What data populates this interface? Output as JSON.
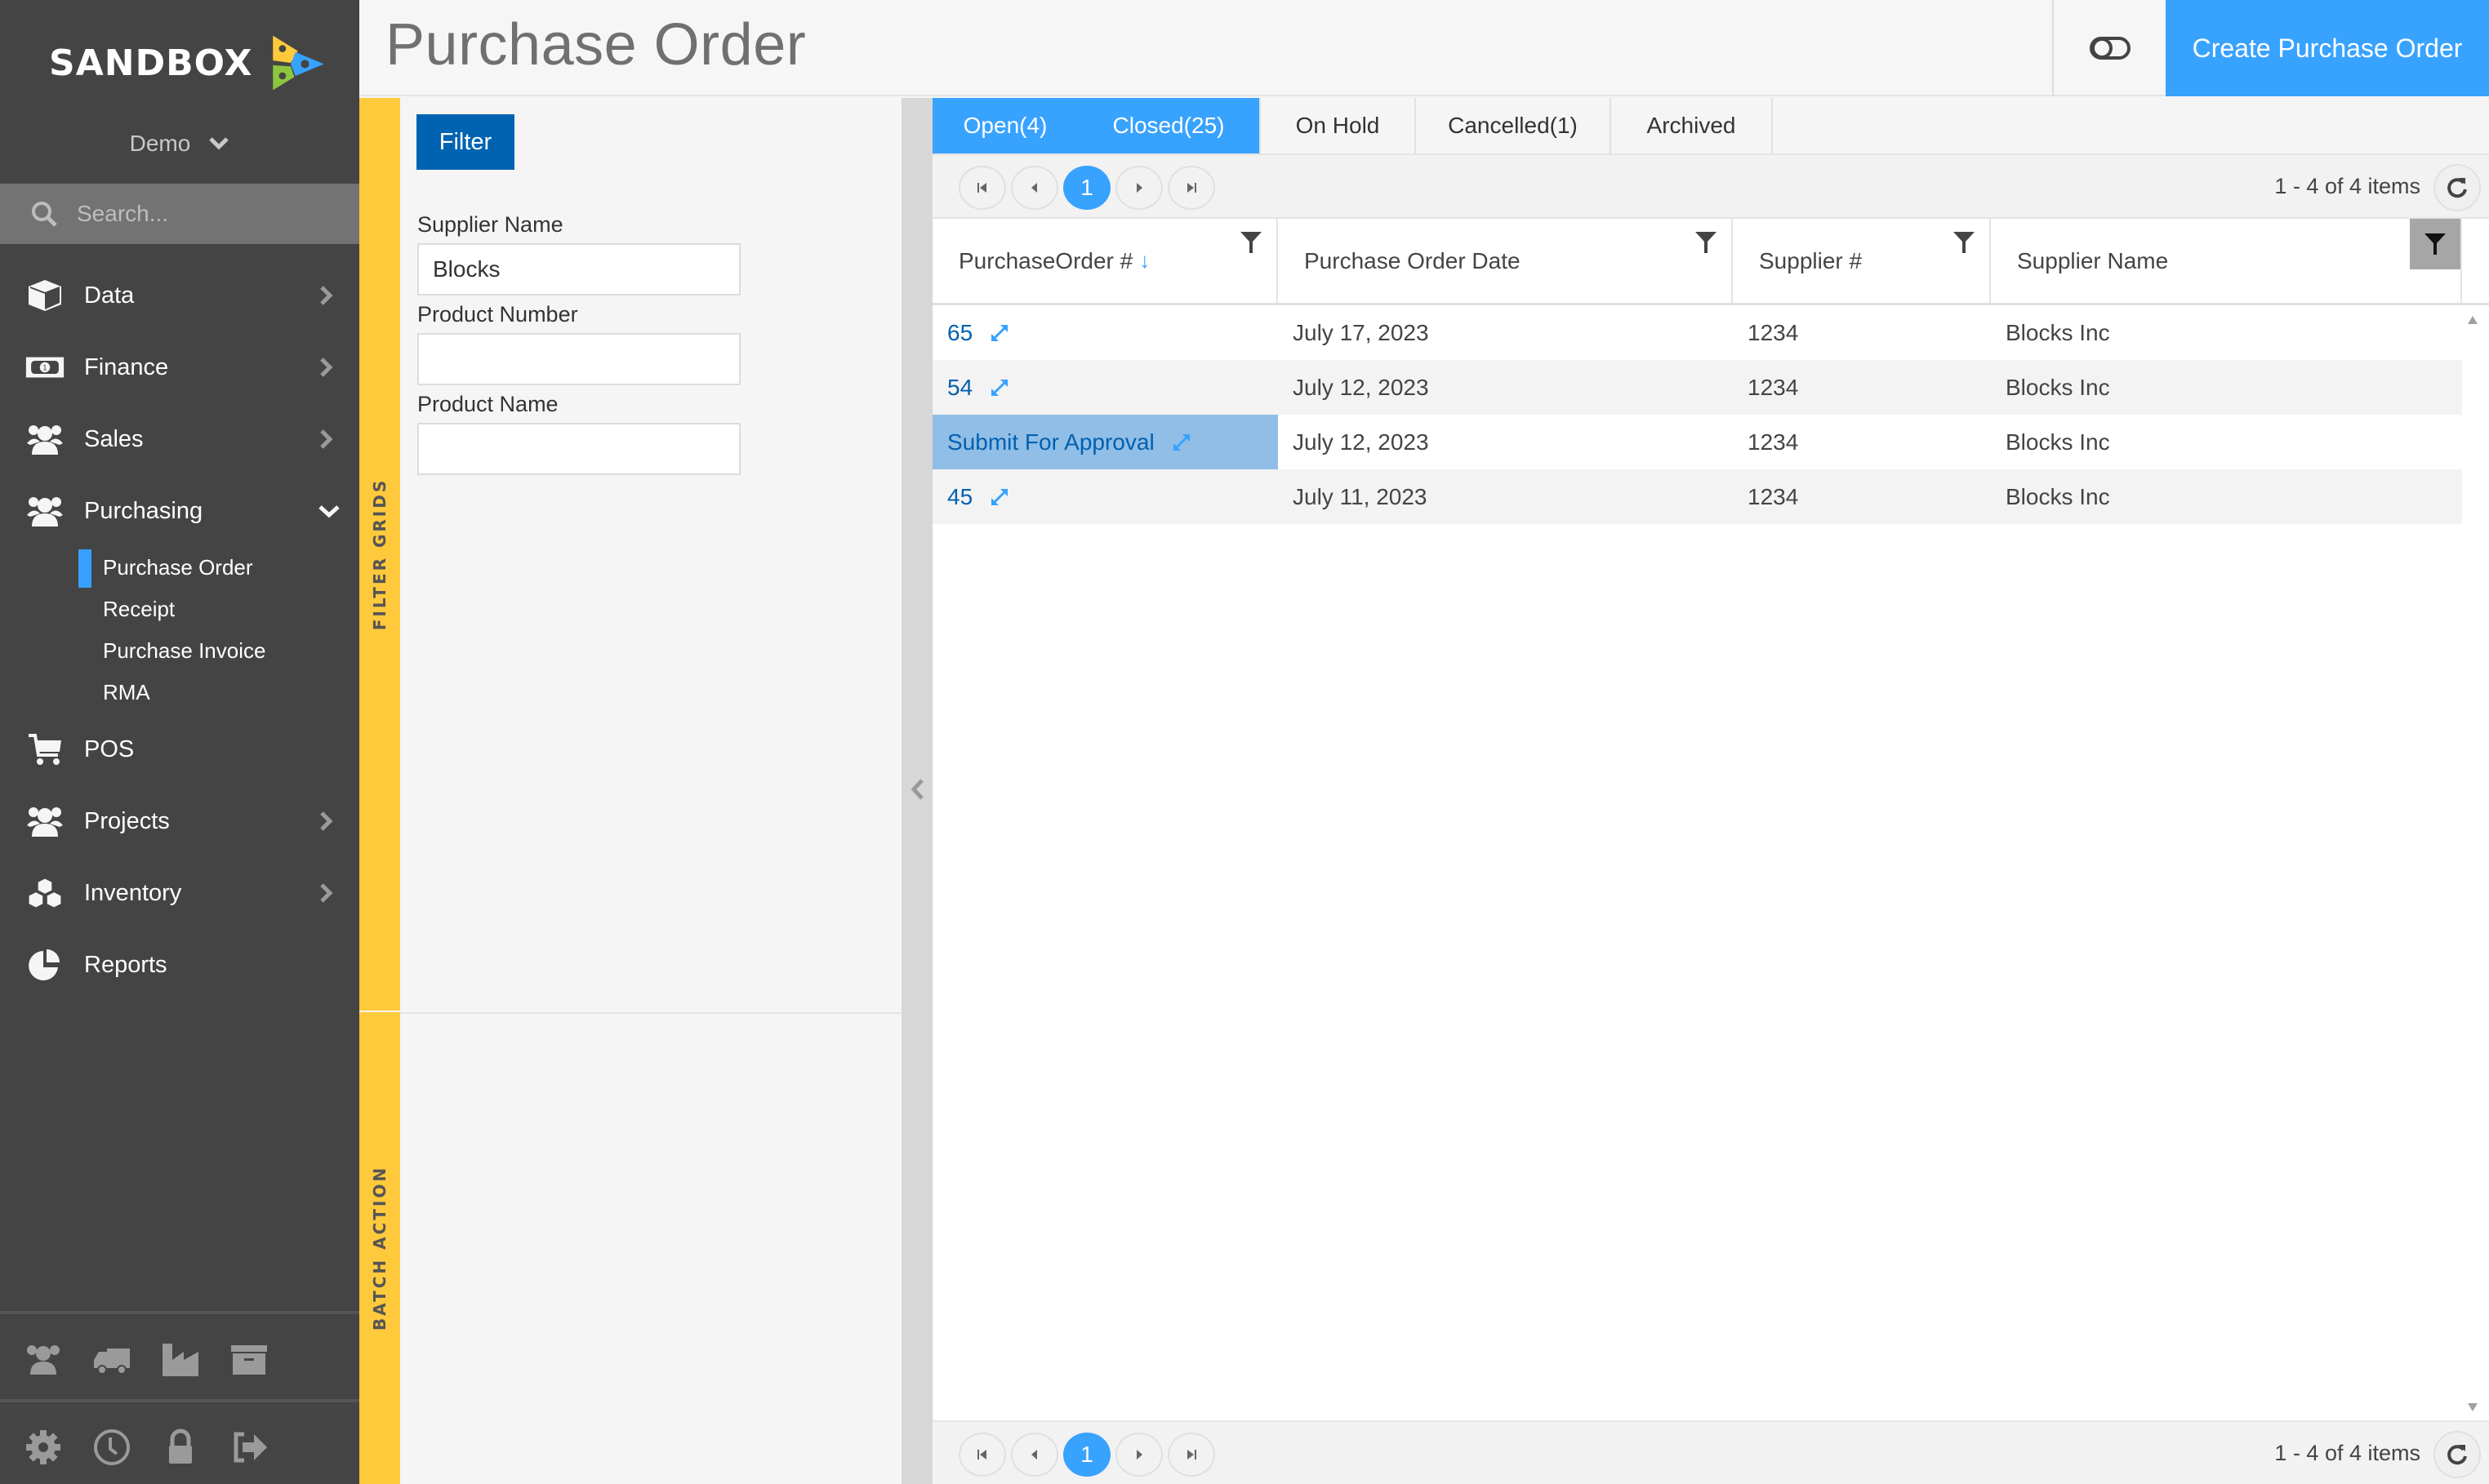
{
  "app": {
    "brand": "SANDBOX",
    "brand_colors": {
      "yellow": "#ffc93c",
      "blue": "#38a2ff",
      "green": "#8cc63f"
    },
    "tenant": "Demo",
    "accent": "#38a2ff"
  },
  "sidebar": {
    "search_placeholder": "Search...",
    "items": [
      {
        "label": "Data",
        "icon": "cube-icon",
        "has_children": true,
        "expanded": false
      },
      {
        "label": "Finance",
        "icon": "money-bill-icon",
        "has_children": true,
        "expanded": false
      },
      {
        "label": "Sales",
        "icon": "users-icon",
        "has_children": true,
        "expanded": false
      },
      {
        "label": "Purchasing",
        "icon": "users-icon",
        "has_children": true,
        "expanded": true,
        "children": [
          {
            "label": "Purchase Order",
            "active": true
          },
          {
            "label": "Receipt",
            "active": false
          },
          {
            "label": "Purchase Invoice",
            "active": false
          },
          {
            "label": "RMA",
            "active": false
          }
        ]
      },
      {
        "label": "POS",
        "icon": "cart-icon",
        "has_children": false,
        "expanded": false
      },
      {
        "label": "Projects",
        "icon": "users-icon",
        "has_children": true,
        "expanded": false
      },
      {
        "label": "Inventory",
        "icon": "cubes-icon",
        "has_children": true,
        "expanded": false
      },
      {
        "label": "Reports",
        "icon": "pie-chart-icon",
        "has_children": false,
        "expanded": false
      }
    ],
    "quick_links": [
      "users-icon",
      "truck-icon",
      "industry-icon",
      "archive-icon"
    ],
    "utility_links": [
      "gear-icon",
      "clock-icon",
      "lock-icon",
      "sign-out-icon"
    ]
  },
  "header": {
    "title": "Purchase Order",
    "toggle_icon": "toggle-off-icon",
    "create_label": "Create Purchase Order"
  },
  "filter_panel": {
    "rail_label": "FILTER GRIDS",
    "filter_button": "Filter",
    "fields": [
      {
        "label": "Supplier Name",
        "value": "Blocks"
      },
      {
        "label": "Product Number",
        "value": ""
      },
      {
        "label": "Product Name",
        "value": ""
      }
    ]
  },
  "batch_panel": {
    "rail_label": "BATCH ACTION"
  },
  "tabs": [
    {
      "label": "Open(4)",
      "active": true
    },
    {
      "label": "Closed(25)",
      "active": false,
      "hover": true
    },
    {
      "label": "On Hold",
      "active": false
    },
    {
      "label": "Cancelled(1)",
      "active": false
    },
    {
      "label": "Archived",
      "active": false
    }
  ],
  "pager": {
    "current_page": "1",
    "info": "1 - 4 of 4 items"
  },
  "grid": {
    "columns": [
      {
        "label": "PurchaseOrder #",
        "sorted": "desc",
        "filter_active": false
      },
      {
        "label": "Purchase Order Date",
        "filter_active": false
      },
      {
        "label": "Supplier #",
        "filter_active": false
      },
      {
        "label": "Supplier Name",
        "filter_active": true
      }
    ],
    "rows": [
      {
        "po": "65",
        "date": "July 17, 2023",
        "supplier_no": "1234",
        "supplier_name": "Blocks Inc",
        "selected": false
      },
      {
        "po": "54",
        "date": "July 12, 2023",
        "supplier_no": "1234",
        "supplier_name": "Blocks Inc",
        "selected": false
      },
      {
        "po": "Submit For Approval",
        "date": "July 12, 2023",
        "supplier_no": "1234",
        "supplier_name": "Blocks Inc",
        "selected": true
      },
      {
        "po": "45",
        "date": "July 11, 2023",
        "supplier_no": "1234",
        "supplier_name": "Blocks Inc",
        "selected": false
      }
    ]
  }
}
